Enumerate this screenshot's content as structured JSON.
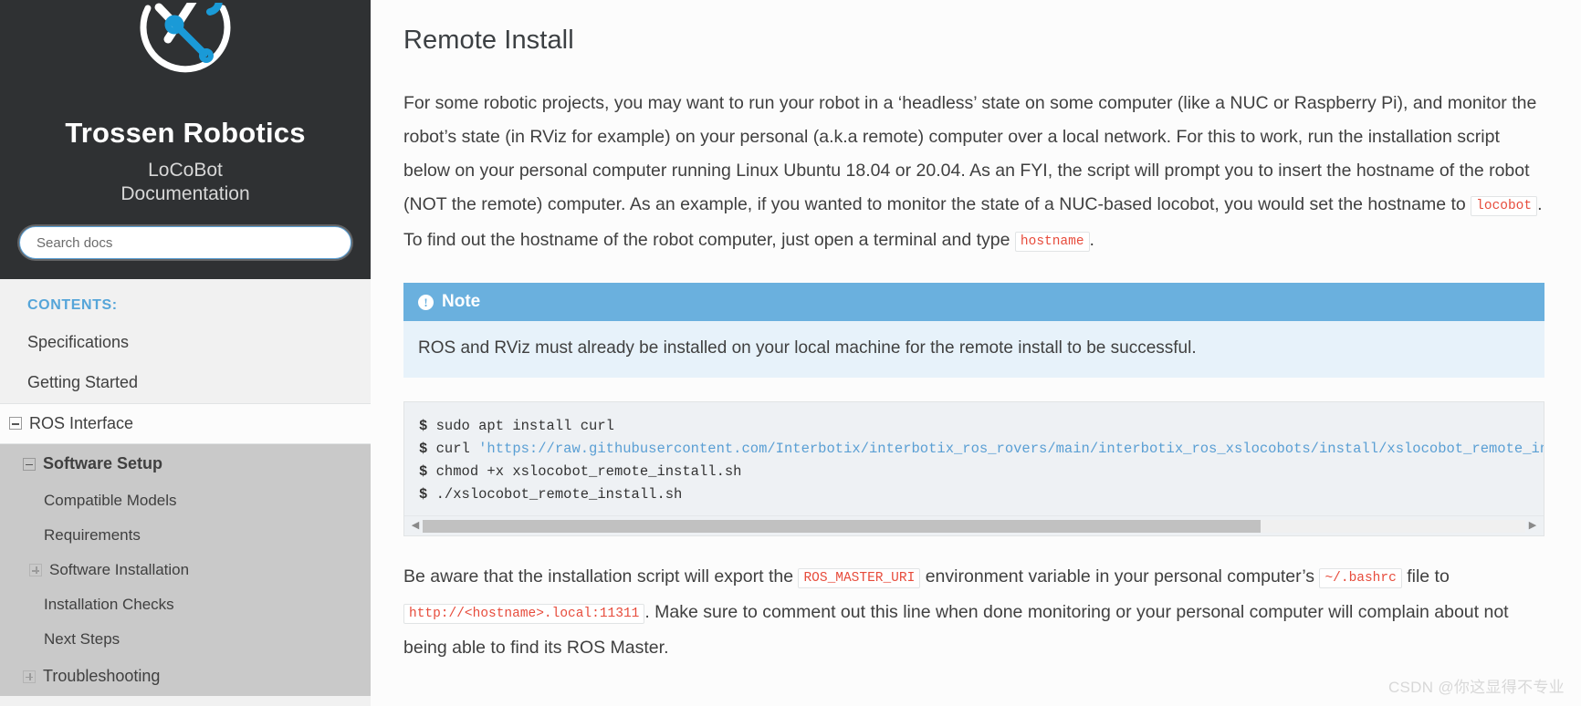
{
  "sidebar": {
    "brand_title": "Trossen Robotics",
    "brand_subtitle": "LoCoBot\nDocumentation",
    "logo_icon": "crossed-wrench-screwdriver-circle-icon",
    "search_placeholder": "Search docs",
    "search_value": "",
    "caption": "CONTENTS:",
    "items": [
      {
        "label": "Specifications",
        "level": 1,
        "toggle": "none",
        "current": false
      },
      {
        "label": "Getting Started",
        "level": 1,
        "toggle": "none",
        "current": false
      },
      {
        "label": "ROS Interface",
        "level": 1,
        "toggle": "minus",
        "current": false,
        "bordered": true
      },
      {
        "label": "Software Setup",
        "level": 2,
        "toggle": "minus",
        "current": true
      },
      {
        "label": "Compatible Models",
        "level": 3,
        "toggle": "none",
        "current": false
      },
      {
        "label": "Requirements",
        "level": 3,
        "toggle": "none",
        "current": false
      },
      {
        "label": "Software Installation",
        "level": 3,
        "toggle": "plus",
        "current": false
      },
      {
        "label": "Installation Checks",
        "level": 3,
        "toggle": "none",
        "current": false
      },
      {
        "label": "Next Steps",
        "level": 3,
        "toggle": "none",
        "current": false
      },
      {
        "label": "Troubleshooting",
        "level": 2,
        "toggle": "plus",
        "current": false
      }
    ]
  },
  "main": {
    "title": "Remote Install",
    "paragraph1": {
      "part1": "For some robotic projects, you may want to run your robot in a ‘headless’ state on some computer (like a NUC or Raspberry Pi), and monitor the robot’s state (in RViz for example) on your personal (a.k.a remote) computer over a local network. For this to work, run the installation script below on your personal computer running Linux Ubuntu 18.04 or 20.04. As an FYI, the script will prompt you to insert the hostname of the robot (NOT the remote) computer. As an example, if you wanted to monitor the state of a NUC-based locobot, you would set the hostname to ",
      "code1": "locobot",
      "part2": ". To find out the hostname of the robot computer, just open a terminal and type ",
      "code2": "hostname",
      "part3": "."
    },
    "note": {
      "title": "Note",
      "icon": "info-circle-icon",
      "body": "ROS and RViz must already be installed on your local machine for the remote install to be successful."
    },
    "code_block": {
      "lines": [
        {
          "prompt": "$",
          "text": " sudo apt install curl"
        },
        {
          "prompt": "$",
          "text": " curl ",
          "string": "'https://raw.githubusercontent.com/Interbotix/interbotix_ros_rovers/main/interbotix_ros_xslocobots/install/xslocobot_remote_install.sh' > xslocobot_remote_install.sh"
        },
        {
          "prompt": "$",
          "text": " chmod +x xslocobot_remote_install.sh"
        },
        {
          "prompt": "$",
          "text": " ./xslocobot_remote_install.sh"
        }
      ],
      "scroll_left_arrow": "◀",
      "scroll_right_arrow": "▶"
    },
    "paragraph2": {
      "part1": "Be aware that the installation script will export the ",
      "code1": "ROS_MASTER_URI",
      "part2": " environment variable in your personal computer’s ",
      "code2": "~/.bashrc",
      "part3": " file to ",
      "code3": "http://<hostname>.local:11311",
      "part4": ". Make sure to comment out this line when done monitoring or your personal computer will complain about not being able to find its ROS Master."
    },
    "watermark": "CSDN @你这显得不专业"
  },
  "colors": {
    "sidebar_bg": "#2f3133",
    "nav_bg": "#f1f1f1",
    "accent_blue": "#55a5d9",
    "note_header": "#6ab0de",
    "note_body": "#e7f2fa",
    "code_bg": "#eef1f4",
    "code_red": "#e74c3c",
    "logo_blue": "#1a9ad7"
  }
}
